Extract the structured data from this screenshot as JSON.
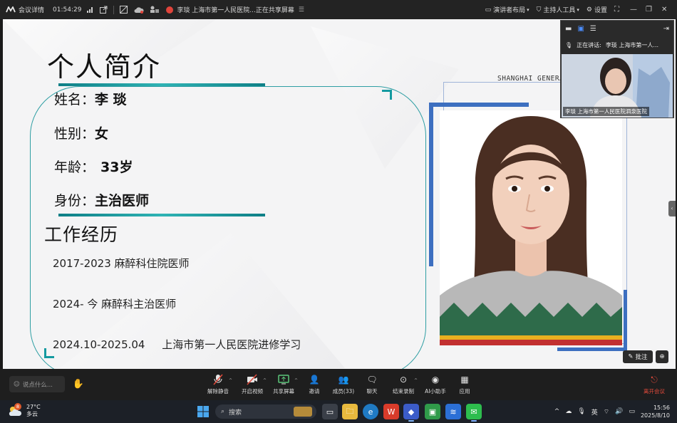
{
  "topbar": {
    "app_label": "会议详情",
    "timer": "01:54:29",
    "sharing_status": "李琰 上海市第一人民医院...正在共享屏幕",
    "presenter_layout": "演讲者布局",
    "host_tools": "主持人工具",
    "settings": "设置"
  },
  "slide": {
    "title": "个人简介",
    "name_label": "姓名：",
    "name_value": "李 琰",
    "gender_label": "性别：",
    "gender_value": "女",
    "age_label": "年龄：",
    "age_value": "33岁",
    "role_label": "身份：",
    "role_value": "主治医师",
    "section_title": "工作经历",
    "experience": [
      "2017-2023 麻醉科住院医师",
      "2024- 今  麻醉科主治医师",
      "2024.10-2025.04     上海市第一人民医院进修学习"
    ],
    "hospital_watermark": "SHANGHAI GENERA"
  },
  "speaker_panel": {
    "speaking_prefix": "正在讲话:",
    "speaking_name": "李琰 上海市第一人...",
    "video_label": "李琰 上海市第一人民医院泗泉医院"
  },
  "annotate": {
    "annotate_label": "批注"
  },
  "toolbar": {
    "chat_placeholder": "说点什么...",
    "buttons": [
      {
        "label": "解除静音",
        "icon": "mic-muted-icon"
      },
      {
        "label": "开启视频",
        "icon": "video-off-icon"
      },
      {
        "label": "共享屏幕",
        "icon": "share-screen-icon"
      },
      {
        "label": "邀请",
        "icon": "invite-icon"
      },
      {
        "label": "成员(33)",
        "icon": "members-icon"
      },
      {
        "label": "聊天",
        "icon": "chat-icon"
      },
      {
        "label": "结束录制",
        "icon": "stop-record-icon"
      },
      {
        "label": "AI小助手",
        "icon": "ai-assistant-icon"
      },
      {
        "label": "应用",
        "icon": "apps-icon"
      }
    ],
    "leave_label": "离开会议"
  },
  "taskbar": {
    "temperature": "27°C",
    "weather": "多云",
    "weather_badge": "8",
    "search_placeholder": "搜索",
    "input_method": "英",
    "time": "15:56",
    "date": "2025/8/10"
  },
  "colors": {
    "accent_teal": "#149aa0",
    "frame_blue": "#3d6fc0",
    "leave_red": "#e24a3b"
  }
}
